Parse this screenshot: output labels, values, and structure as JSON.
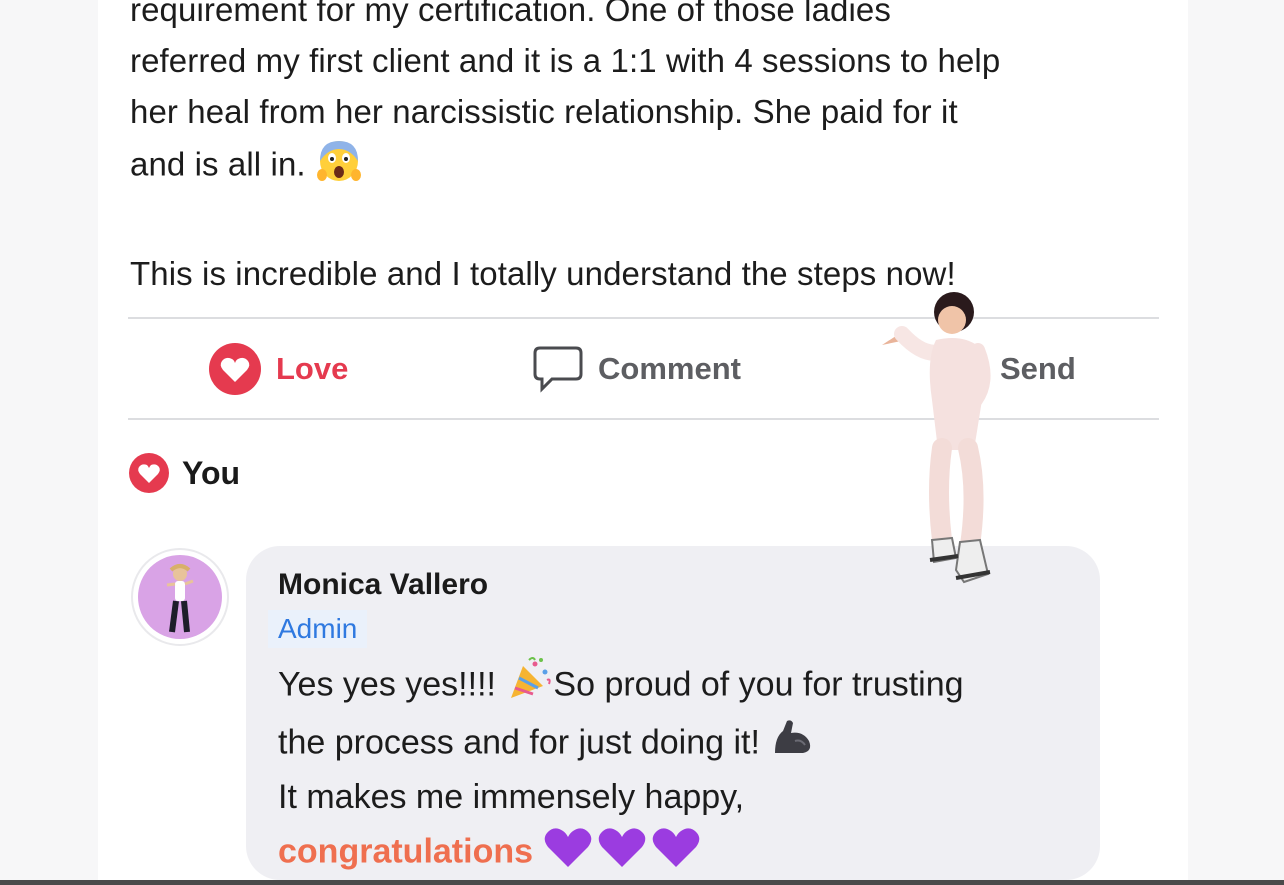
{
  "post": {
    "line1": "requirement for my certification. One of those ladies",
    "line2": "referred my first client and it is a 1:1 with 4 sessions to help",
    "line3": "her heal from her narcissistic relationship. She paid for it",
    "line4": "and is all in.",
    "line4_emoji": "screaming-face-emoji",
    "line5": "This is incredible and I totally understand the steps now!"
  },
  "actions": {
    "love_label": "Love",
    "comment_label": "Comment",
    "send_label": "Send"
  },
  "reactions": {
    "label": "You",
    "icon": "heart-icon"
  },
  "comment": {
    "author": "Monica Vallero",
    "role": "Admin",
    "line1_a": "Yes yes yes!!!!",
    "line1_emoji": "party-popper-emoji",
    "line1_b": "So proud of you for trusting",
    "line2": "the process and for just doing it!",
    "line2_emoji": "flexed-biceps-emoji",
    "line3": "It makes me immensely happy,",
    "line4": "congratulations",
    "line4_emoji": "purple-hearts-emoji"
  },
  "colors": {
    "love_red": "#e53a4f",
    "admin_blue": "#2f79e0",
    "accent_orange": "#ef6f4f",
    "bubble_bg": "#efeff3"
  }
}
